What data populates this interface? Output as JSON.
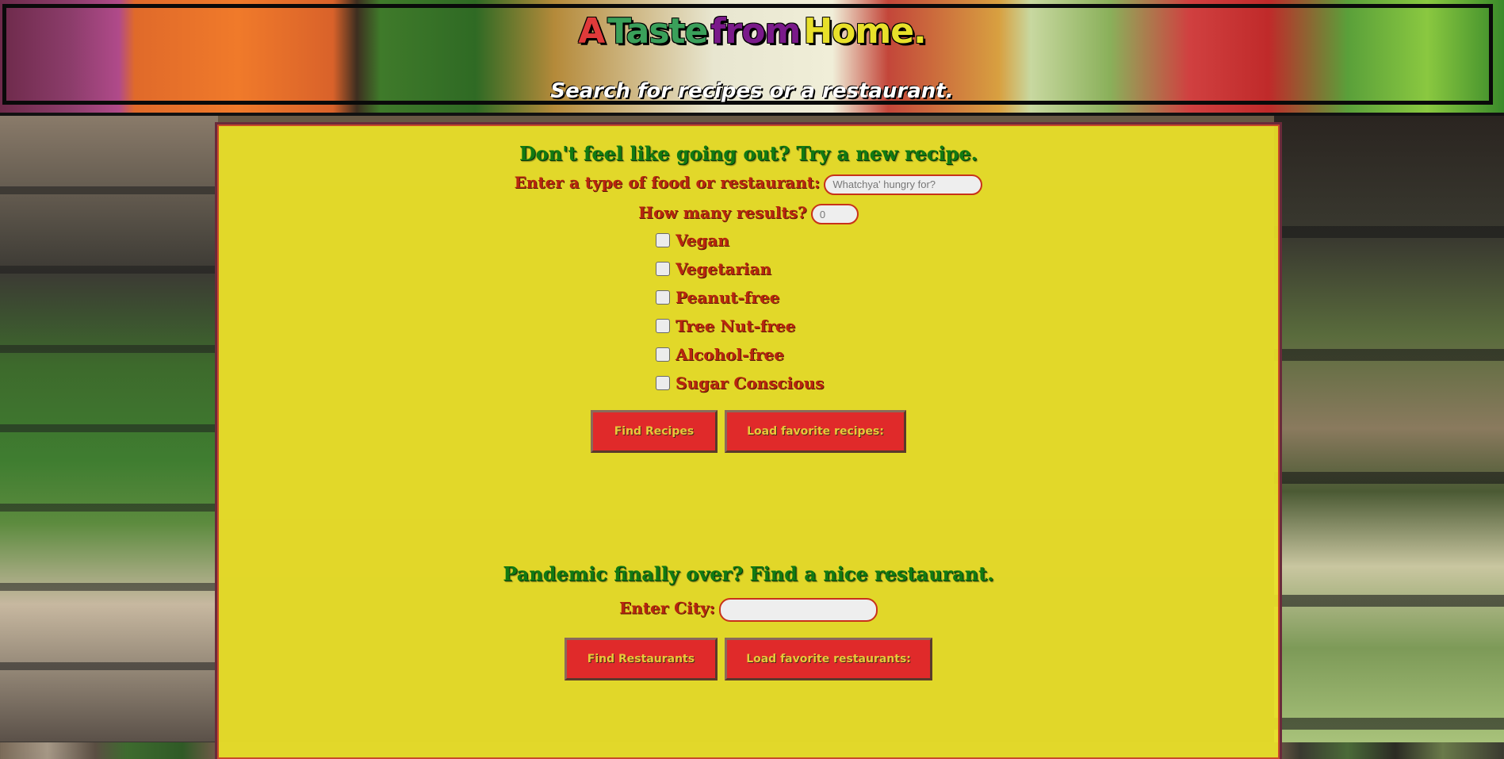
{
  "header": {
    "title_parts": [
      "A",
      "Taste",
      "from",
      "Home."
    ],
    "subtitle": "Search for recipes or a restaurant."
  },
  "recipes": {
    "title": "Don't feel like going out? Try a new recipe.",
    "food_label": "Enter a type of food or restaurant:",
    "food_input": {
      "value": "",
      "placeholder": "Whatchya' hungry for?"
    },
    "results_label": "How many results?",
    "results_input": {
      "value": "",
      "placeholder": "0"
    },
    "filters": [
      {
        "label": "Vegan",
        "checked": false
      },
      {
        "label": "Vegetarian",
        "checked": false
      },
      {
        "label": "Peanut-free",
        "checked": false
      },
      {
        "label": "Tree Nut-free",
        "checked": false
      },
      {
        "label": "Alcohol-free",
        "checked": false
      },
      {
        "label": "Sugar Conscious",
        "checked": false
      }
    ],
    "find_button": "Find Recipes",
    "load_button": "Load favorite recipes:"
  },
  "restaurants": {
    "title": "Pandemic finally over? Find a nice restaurant.",
    "city_label": "Enter City:",
    "city_input": {
      "value": "",
      "placeholder": ""
    },
    "find_button": "Find Restaurants",
    "load_button": "Load favorite restaurants:"
  },
  "colors": {
    "panel": "#ece228",
    "heading_green": "#127a12",
    "label_red": "#b8260e",
    "button_red": "#e02a2a",
    "button_text": "#e8c83a"
  }
}
